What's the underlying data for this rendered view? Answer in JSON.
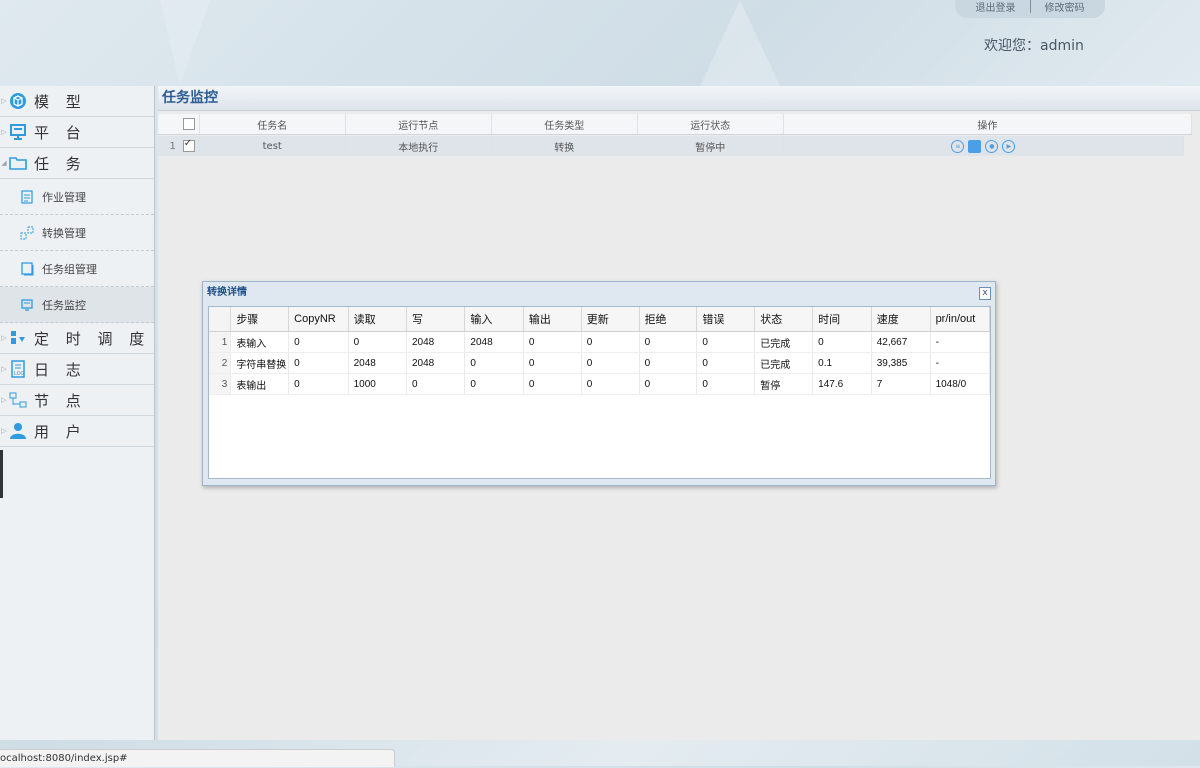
{
  "header": {
    "links": [
      "退出登录",
      "修改密码"
    ],
    "welcome": "欢迎您：admin"
  },
  "sidebar": {
    "items": [
      {
        "label": "模 型",
        "icon": "cube-icon",
        "expanded": false
      },
      {
        "label": "平 台",
        "icon": "monitor-icon",
        "expanded": false
      },
      {
        "label": "任 务",
        "icon": "folder-icon",
        "expanded": true
      },
      {
        "label": "定 时 调 度",
        "icon": "schedule-icon",
        "expanded": false
      },
      {
        "label": "日 志",
        "icon": "log-icon",
        "expanded": false
      },
      {
        "label": "节 点",
        "icon": "node-icon",
        "expanded": false
      },
      {
        "label": "用 户",
        "icon": "user-icon",
        "expanded": false
      }
    ],
    "subitems": [
      {
        "label": "作业管理",
        "icon": "clipboard-icon"
      },
      {
        "label": "转换管理",
        "icon": "transform-icon"
      },
      {
        "label": "任务组管理",
        "icon": "group-icon"
      },
      {
        "label": "任务监控",
        "icon": "monitor-icon",
        "active": true
      }
    ]
  },
  "main": {
    "title": "任务监控",
    "columns": [
      "任务名",
      "运行节点",
      "任务类型",
      "运行状态",
      "操作"
    ],
    "rows": [
      {
        "num": "1",
        "checked": true,
        "name": "test",
        "node": "本地执行",
        "type": "转换",
        "status": "暂停中"
      }
    ]
  },
  "dialog": {
    "title": "转换详情",
    "close": "x",
    "columns": [
      "步骤",
      "CopyNR",
      "读取",
      "写",
      "输入",
      "输出",
      "更新",
      "拒绝",
      "错误",
      "状态",
      "时间",
      "速度",
      "pr/in/out"
    ],
    "rows": [
      [
        "1",
        "表输入",
        "0",
        "0",
        "2048",
        "2048",
        "0",
        "0",
        "0",
        "0",
        "已完成",
        "0",
        "42,667",
        "-"
      ],
      [
        "2",
        "字符串替换",
        "0",
        "2048",
        "2048",
        "0",
        "0",
        "0",
        "0",
        "0",
        "已完成",
        "0.1",
        "39,385",
        "-"
      ],
      [
        "3",
        "表输出",
        "0",
        "1000",
        "0",
        "0",
        "0",
        "0",
        "0",
        "0",
        "暂停",
        "147.6",
        "7",
        "1048/0"
      ]
    ]
  },
  "statusbar": {
    "url": "ocalhost:8080/index.jsp#"
  },
  "colors": {
    "accent": "#2c5c94",
    "op_icon": "#4b9fe6"
  }
}
